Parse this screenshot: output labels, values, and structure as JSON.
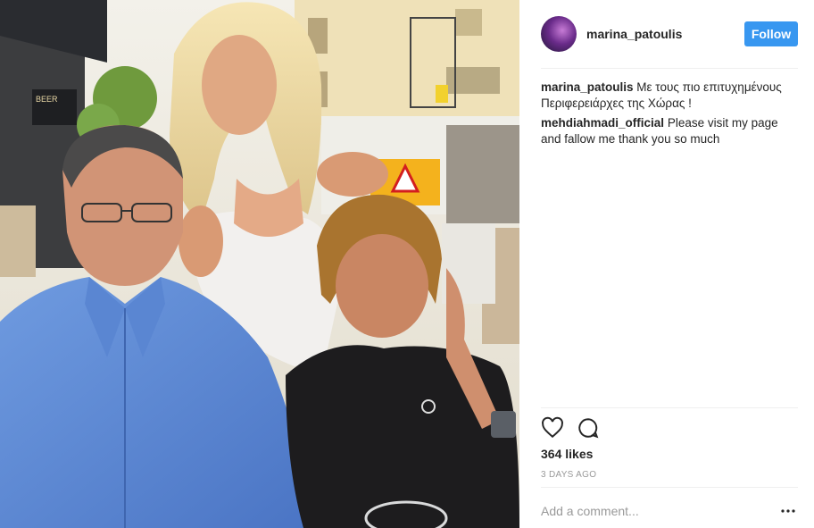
{
  "post": {
    "author": {
      "username": "marina_patoulis",
      "avatar_icon": "profile-avatar"
    },
    "follow_label": "Follow",
    "photo": {
      "sign_text": "BEER"
    },
    "comments": [
      {
        "author": "marina_patoulis",
        "text": "Με τους πιο επιτυχημένους Περιφερειάρχες της Χώρας !"
      },
      {
        "author": "mehdiahmadi_official",
        "text": "Please visit my page and fallow me thank you so much"
      }
    ],
    "likes": "364 likes",
    "timestamp": "3 DAYS AGO",
    "add_comment_placeholder": "Add a comment...",
    "icons": {
      "like": "heart-icon",
      "comment": "comment-icon",
      "more": "more-options-icon"
    },
    "colors": {
      "accent": "#3897f0",
      "text": "#262626",
      "muted": "#999999",
      "divider": "#efefef"
    }
  }
}
